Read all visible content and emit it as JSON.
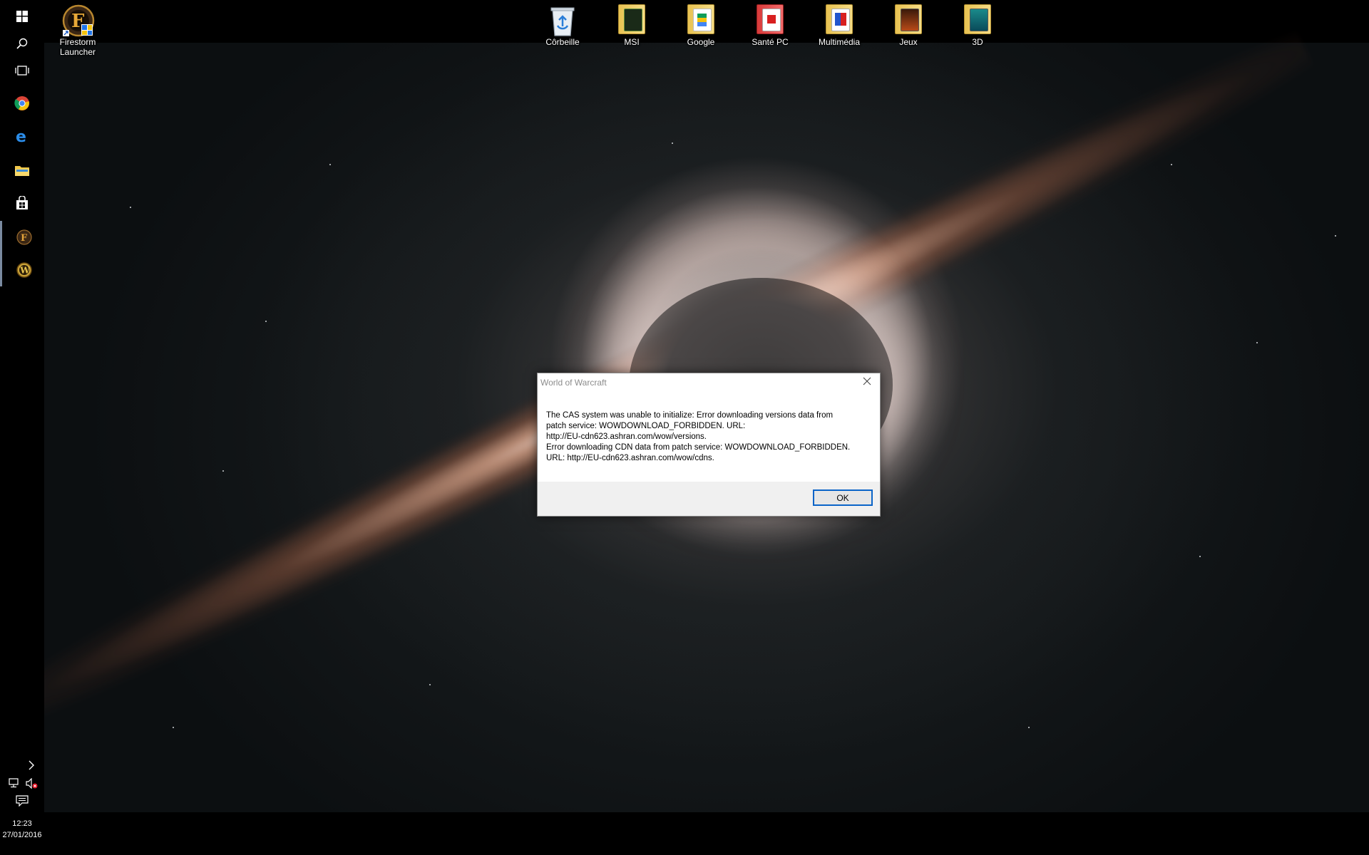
{
  "desktop": {
    "icons": [
      {
        "label": "Firestorm Launcher",
        "icon": "firestorm-launcher-icon"
      },
      {
        "label": "Côrbeille",
        "icon": "recycle-bin-icon"
      },
      {
        "label": "MSI",
        "icon": "folder-icon"
      },
      {
        "label": "Google",
        "icon": "folder-icon"
      },
      {
        "label": "Santé PC",
        "icon": "folder-icon"
      },
      {
        "label": "Multimédia",
        "icon": "folder-icon"
      },
      {
        "label": "Jeux",
        "icon": "folder-icon"
      },
      {
        "label": "3D",
        "icon": "folder-icon"
      }
    ]
  },
  "taskbar": {
    "buttons": [
      {
        "name": "start-button",
        "icon": "windows-logo-icon"
      },
      {
        "name": "search-button",
        "icon": "search-icon"
      },
      {
        "name": "task-view-button",
        "icon": "task-view-icon"
      },
      {
        "name": "chrome-button",
        "icon": "chrome-icon"
      },
      {
        "name": "edge-button",
        "icon": "edge-icon"
      },
      {
        "name": "file-explorer-button",
        "icon": "folder-icon"
      },
      {
        "name": "store-button",
        "icon": "store-icon"
      },
      {
        "name": "firestorm-button",
        "icon": "firestorm-icon"
      },
      {
        "name": "world-of-warcraft-button",
        "icon": "wow-icon"
      }
    ],
    "tray": {
      "time": "12:23",
      "date": "27/01/2016"
    }
  },
  "dialog": {
    "title": "World of Warcraft",
    "message_lines": [
      "The CAS system was unable to initialize: Error downloading versions data from",
      "patch service: WOWDOWNLOAD_FORBIDDEN. URL:",
      "http://EU-cdn623.ashran.com/wow/versions.",
      "Error downloading CDN data from patch service: WOWDOWNLOAD_FORBIDDEN.",
      "URL: http://EU-cdn623.ashran.com/wow/cdns."
    ],
    "ok_label": "OK"
  },
  "colors": {
    "accent": "#0a64c8",
    "taskbar": "#000000"
  }
}
